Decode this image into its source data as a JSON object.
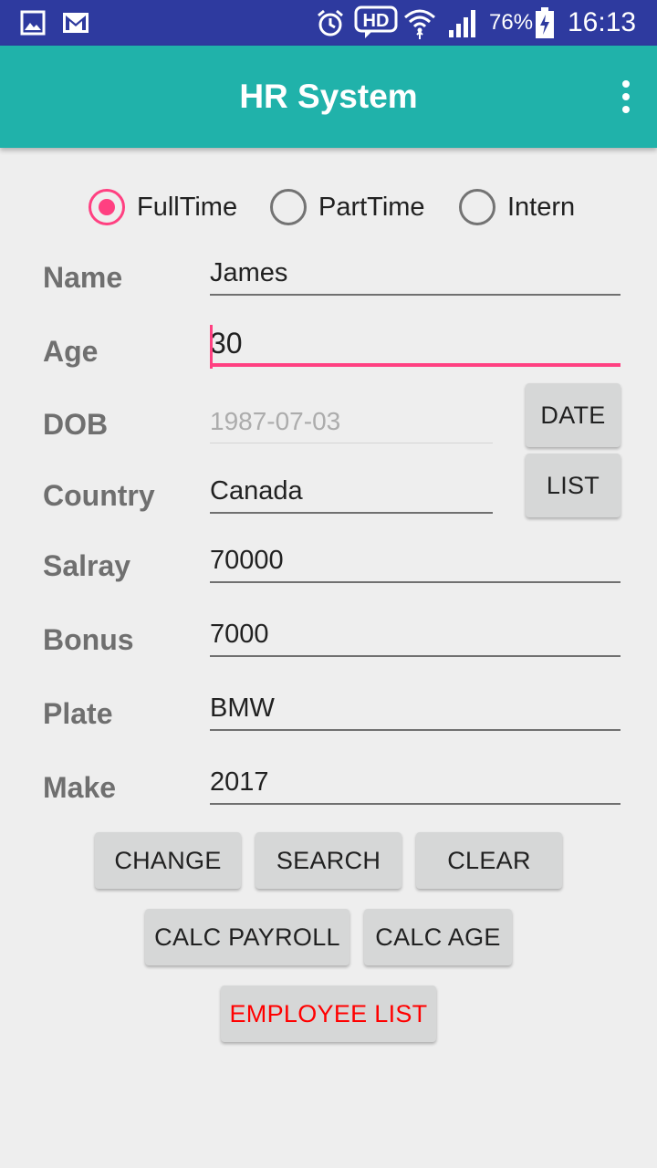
{
  "statusbar": {
    "battery_percent": "76%",
    "time": "16:13",
    "icons": [
      "gallery-icon",
      "gmail-icon",
      "alarm-icon",
      "hd-voice-icon",
      "wifi-icon",
      "signal-icon",
      "battery-charging-icon"
    ]
  },
  "appbar": {
    "title": "HR System",
    "menu_icon": "more-vert-icon"
  },
  "employee_type": {
    "options": [
      "FullTime",
      "PartTime",
      "Intern"
    ],
    "selected": "FullTime"
  },
  "form": {
    "name_label": "Name",
    "name_value": "James",
    "age_label": "Age",
    "age_value": "30",
    "dob_label": "DOB",
    "dob_value": "1987-07-03",
    "country_label": "Country",
    "country_value": "Canada",
    "salary_label": "Salray",
    "salary_value": "70000",
    "bonus_label": "Bonus",
    "bonus_value": "7000",
    "plate_label": "Plate",
    "plate_value": "BMW",
    "make_label": "Make",
    "make_value": "2017"
  },
  "side_buttons": {
    "date": "DATE",
    "list": "LIST"
  },
  "actions": {
    "change": "CHANGE",
    "search": "SEARCH",
    "clear": "CLEAR",
    "calc_payroll": "CALC PAYROLL",
    "calc_age": "CALC AGE",
    "employee_list": "EMPLOYEE LIST"
  },
  "colors": {
    "statusbar": "#2E3A9F",
    "appbar": "#20B2AA",
    "accent": "#FF4081",
    "employee_list_text": "#FF0000"
  }
}
